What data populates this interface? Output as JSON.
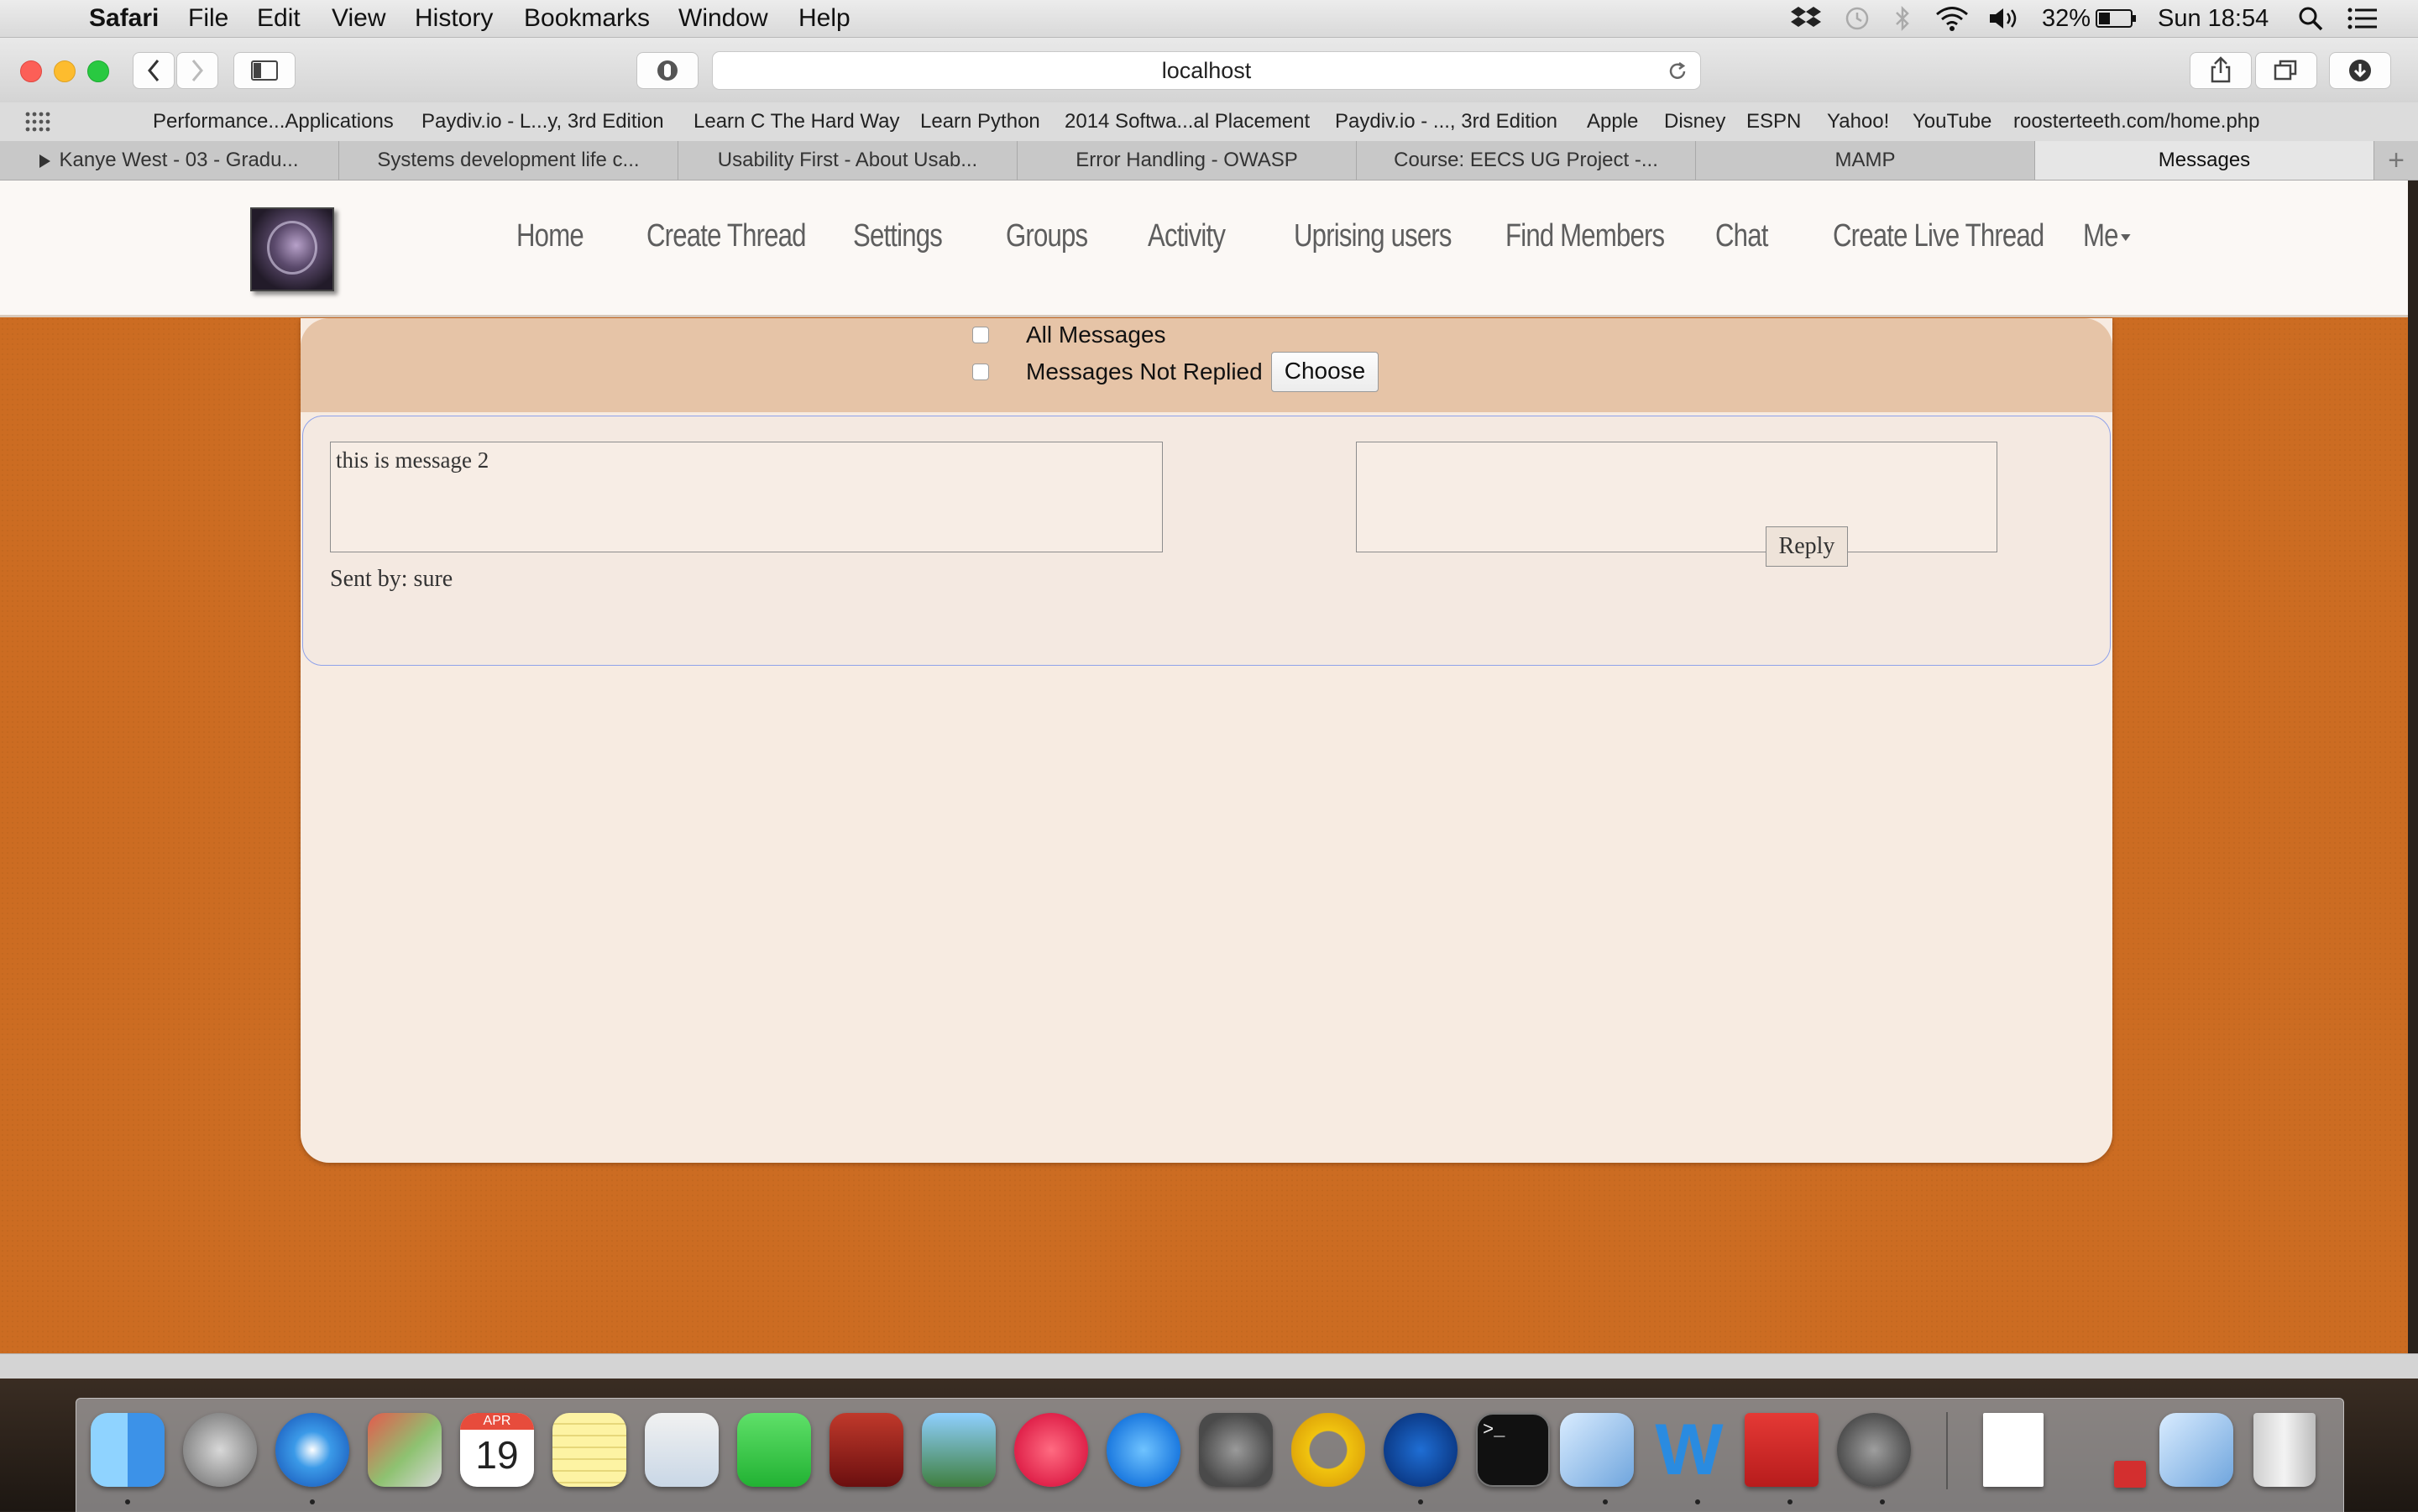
{
  "menubar": {
    "app": "Safari",
    "items": [
      "File",
      "Edit",
      "View",
      "History",
      "Bookmarks",
      "Window",
      "Help"
    ],
    "battery": "32%",
    "clock": "Sun 18:54"
  },
  "browser": {
    "url": "localhost",
    "favorites": [
      "Performance...Applications",
      "Paydiv.io - L...y, 3rd Edition",
      "Learn C The Hard Way",
      "Learn Python",
      "2014 Softwa...al Placement",
      "Paydiv.io - ..., 3rd Edition",
      "Apple",
      "Disney",
      "ESPN",
      "Yahoo!",
      "YouTube",
      "roosterteeth.com/home.php"
    ],
    "tabs": [
      "Kanye West - 03 - Gradu...",
      "Systems development life c...",
      "Usability First - About Usab...",
      "Error Handling - OWASP",
      "Course: EECS UG Project -...",
      "MAMP",
      "Messages"
    ],
    "active_tab": 6
  },
  "nav": {
    "items": [
      "Home",
      "Create Thread",
      "Settings",
      "Groups",
      "Activity",
      "Uprising users",
      "Find Members",
      "Chat",
      "Create Live Thread",
      "Me"
    ]
  },
  "filter": {
    "all_label": "All Messages",
    "not_replied_label": "Messages Not Replied",
    "choose_label": "Choose"
  },
  "message": {
    "text": "this is message 2",
    "sent_by": "Sent by: sure",
    "reply_value": "",
    "reply_button": "Reply"
  },
  "dock": {
    "calendar_month": "APR",
    "calendar_day": "19",
    "apps": [
      "finder-icon",
      "launchpad-icon",
      "safari-icon",
      "preview-icon",
      "calendar-icon",
      "notes-icon",
      "ical-icon",
      "facetime-icon",
      "photobooth-icon",
      "iphoto-icon",
      "itunes-icon",
      "app-store-icon",
      "system-preferences-icon",
      "opera-icon",
      "wireshark-icon",
      "terminal-icon",
      "virtualbox-icon",
      "word-icon",
      "acrobat-icon",
      "mamp-icon",
      "document-icon",
      "pdf-file-icon",
      "virtualbox-doc-icon",
      "trash-icon"
    ]
  }
}
